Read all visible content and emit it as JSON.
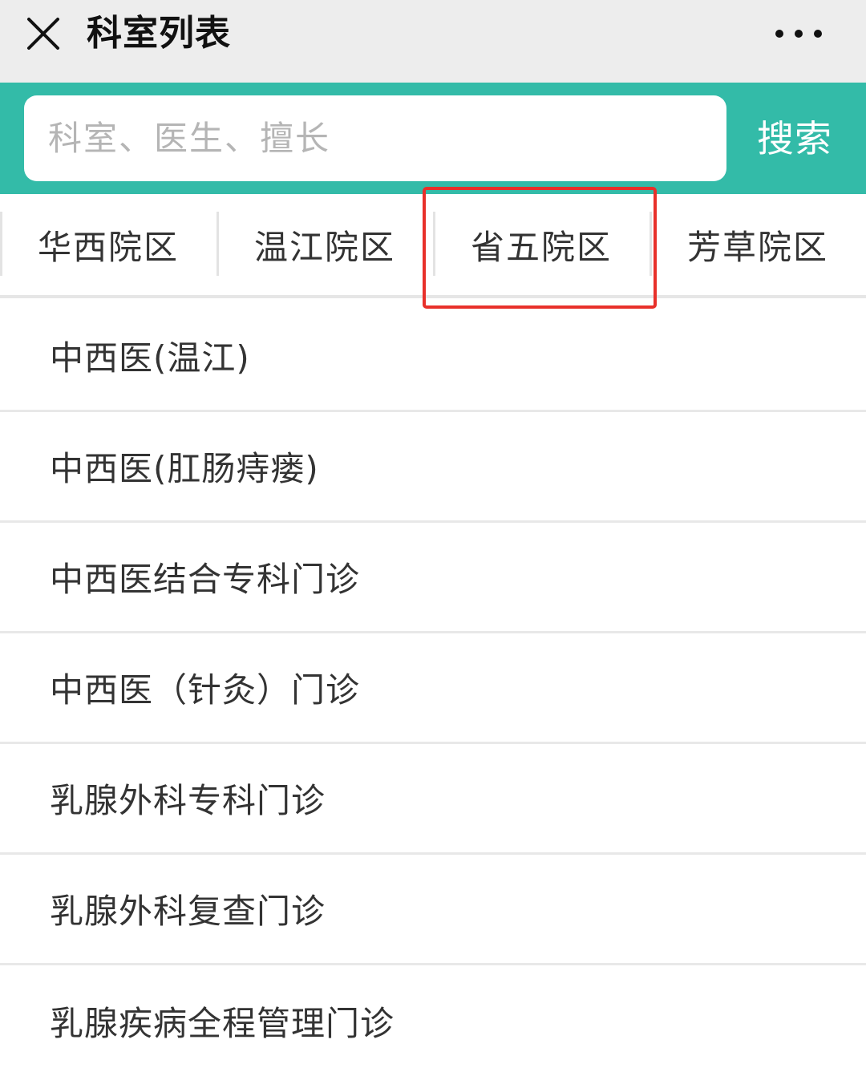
{
  "header": {
    "title": "科室列表",
    "close_icon": "close-icon",
    "more_icon": "more-icon"
  },
  "search": {
    "placeholder": "科室、医生、擅长",
    "value": "",
    "button_label": "搜索",
    "bar_color": "#33bba8"
  },
  "tabs": [
    {
      "label": "华西院区"
    },
    {
      "label": "温江院区"
    },
    {
      "label": "省五院区"
    },
    {
      "label": "芳草院区"
    }
  ],
  "highlight_color": "#e8302a",
  "departments": [
    {
      "name": "中西医(温江)"
    },
    {
      "name": "中西医(肛肠痔瘘)"
    },
    {
      "name": "中西医结合专科门诊"
    },
    {
      "name": "中西医（针灸）门诊"
    },
    {
      "name": "乳腺外科专科门诊"
    },
    {
      "name": "乳腺外科复查门诊"
    },
    {
      "name": "乳腺疾病全程管理门诊"
    }
  ]
}
